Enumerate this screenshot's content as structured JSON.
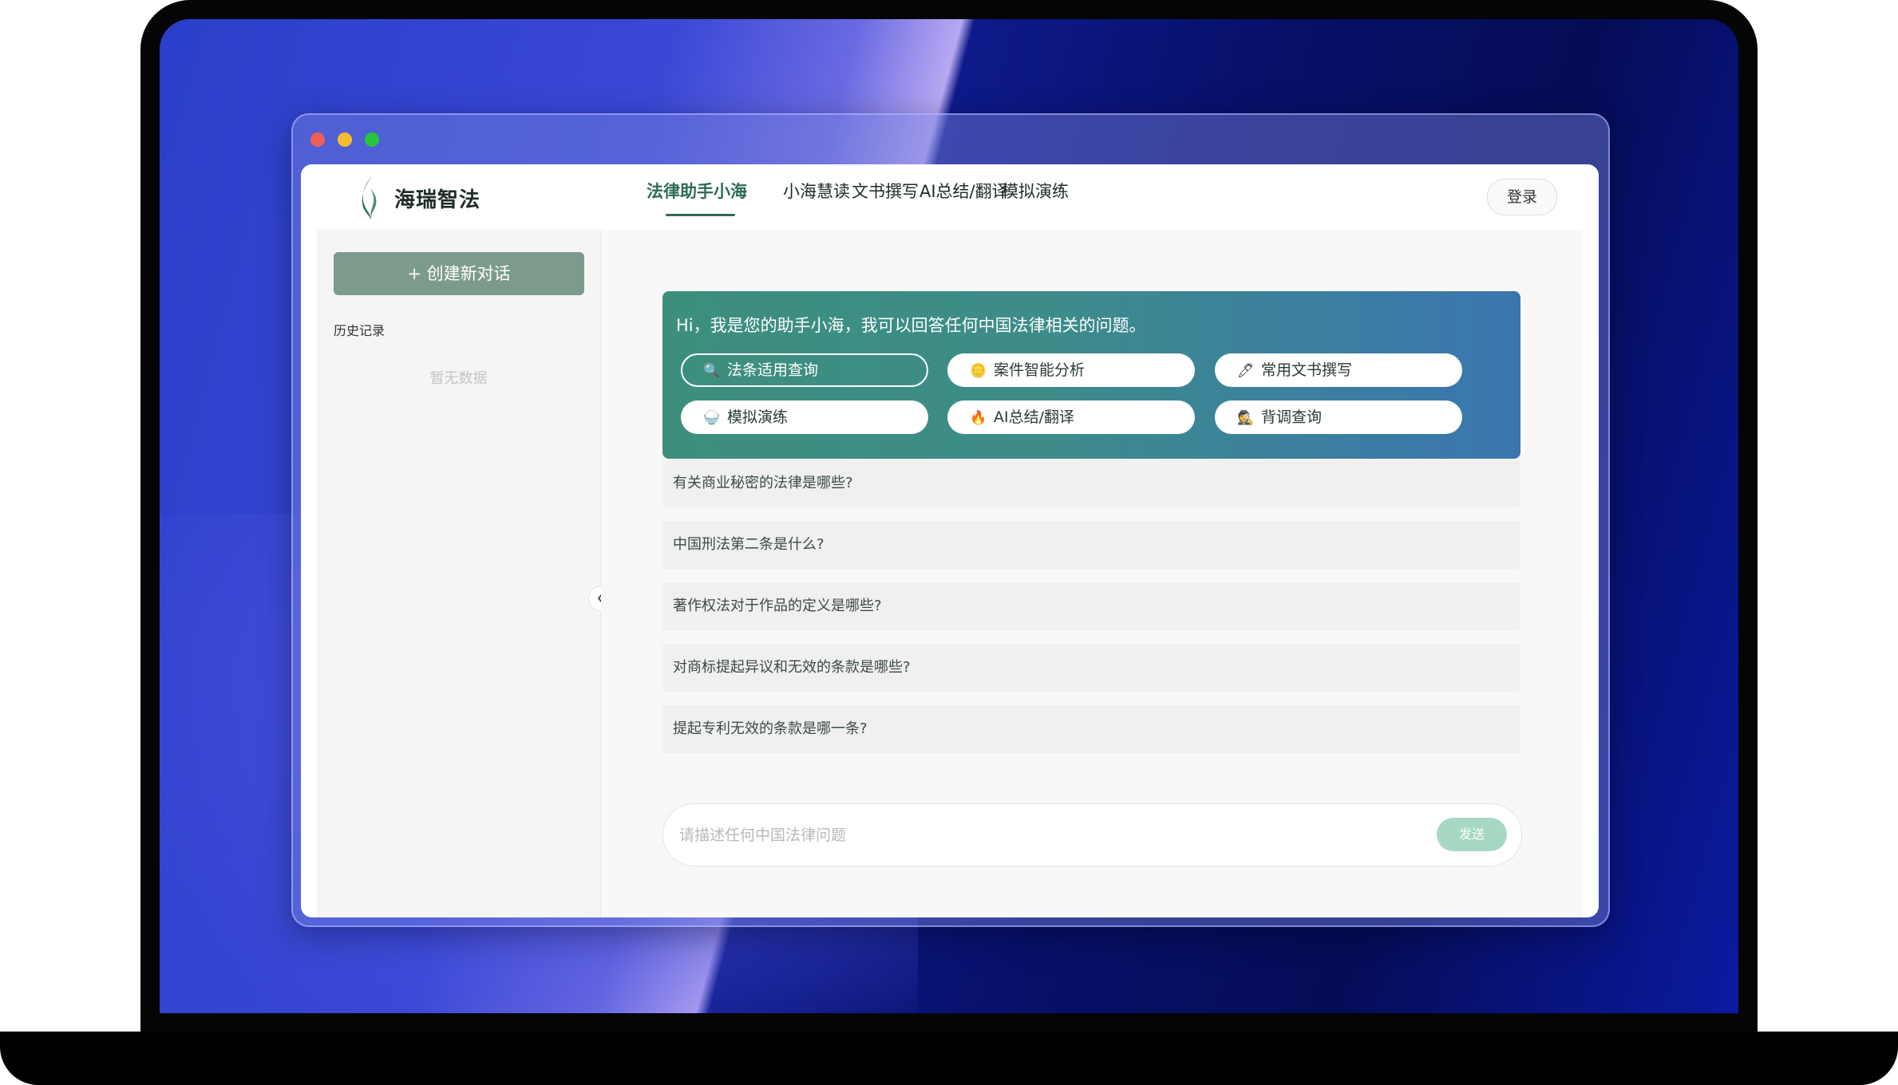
{
  "app": {
    "brand": "海瑞智法",
    "login_label": "登录"
  },
  "nav": {
    "items": [
      "法律助手小海",
      "小海慧读",
      "文书撰写",
      "AI总结/翻译",
      "模拟演练"
    ],
    "active": "法律助手小海"
  },
  "sidebar": {
    "new_chat_label": "+ 创建新对话",
    "history_label": "历史记录",
    "empty_label": "暂无数据"
  },
  "banner": {
    "greeting": "Hi，我是您的助手小海，我可以回答任何中国法律相关的问题。",
    "chips": [
      {
        "label": "法条适用查询",
        "icon": "magnifier-icon",
        "glyph": "🔍",
        "selected": true
      },
      {
        "label": "案件智能分析",
        "icon": "coin-icon",
        "glyph": "🪙",
        "selected": false
      },
      {
        "label": "常用文书撰写",
        "icon": "pen-icon",
        "glyph": "🖊",
        "selected": false
      },
      {
        "label": "模拟演练",
        "icon": "rice-bowl-icon",
        "glyph": "🍚",
        "selected": false
      },
      {
        "label": "AI总结/翻译",
        "icon": "fire-icon",
        "glyph": "🔥",
        "selected": false
      },
      {
        "label": "背调查询",
        "icon": "detective-icon",
        "glyph": "🕵",
        "selected": false
      }
    ]
  },
  "suggestions": [
    "有关商业秘密的法律是哪些?",
    "中国刑法第二条是什么?",
    "著作权法对于作品的定义是哪些?",
    "对商标提起异议和无效的条款是哪些?",
    "提起专利无效的条款是哪一条?"
  ],
  "input": {
    "placeholder": "请描述任何中国法律问题",
    "value": "",
    "send_label": "发送"
  },
  "colors": {
    "accent": "#2c6a57",
    "banner_start": "#3d8f7c",
    "banner_end": "#3b75b0",
    "send_button": "#a7d8c4",
    "new_chat_button": "#7d9b8d"
  }
}
